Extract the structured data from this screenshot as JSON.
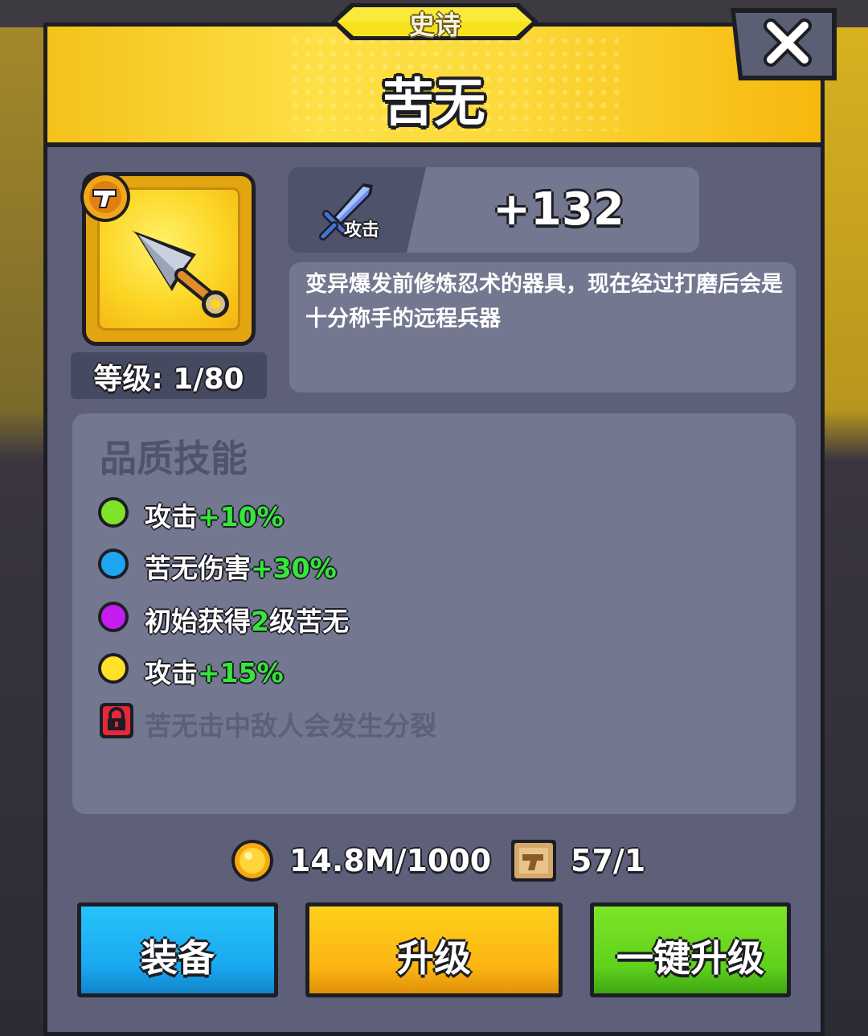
{
  "header": {
    "rarity": "史诗",
    "title": "苦无"
  },
  "item": {
    "icon": "kunai-icon",
    "badge_icon": "pistol-badge-icon",
    "level_text": "等级: 1/80"
  },
  "stat": {
    "icon": "sword-icon",
    "label": "攻击",
    "value": "+132"
  },
  "description": "变异爆发前修炼忍术的器具，现在经过打磨后会是十分称手的远程兵器",
  "skills": {
    "title": "品质技能",
    "items": [
      {
        "color": "#7fe32a",
        "text": "攻击",
        "highlight": "+10%",
        "suffix": "",
        "locked": false
      },
      {
        "color": "#1fa6f2",
        "text": "苦无伤害",
        "highlight": "+30%",
        "suffix": "",
        "locked": false
      },
      {
        "color": "#c31df0",
        "text": "初始获得",
        "highlight": "2",
        "suffix": "级苦无",
        "locked": false
      },
      {
        "color": "#ffe12a",
        "text": "攻击",
        "highlight": "+15%",
        "suffix": "",
        "locked": false
      },
      {
        "color": "#e8273a",
        "text": "苦无击中敌人会发生分裂",
        "highlight": "",
        "suffix": "",
        "locked": true
      }
    ]
  },
  "cost": {
    "coin_icon": "gold-coin-icon",
    "coin_text": "14.8M/1000",
    "scroll_icon": "blueprint-scroll-icon",
    "scroll_text": "57/1"
  },
  "buttons": {
    "equip": "装备",
    "upgrade": "升级",
    "upgrade_all": "一键升级"
  },
  "colors": {
    "header": "#fcd93a",
    "panel": "#5d6078",
    "equip": "#19a8ef",
    "upgrade": "#fbb512",
    "upgrade_all": "#5fd11c",
    "highlight_green": "#33e83a"
  }
}
